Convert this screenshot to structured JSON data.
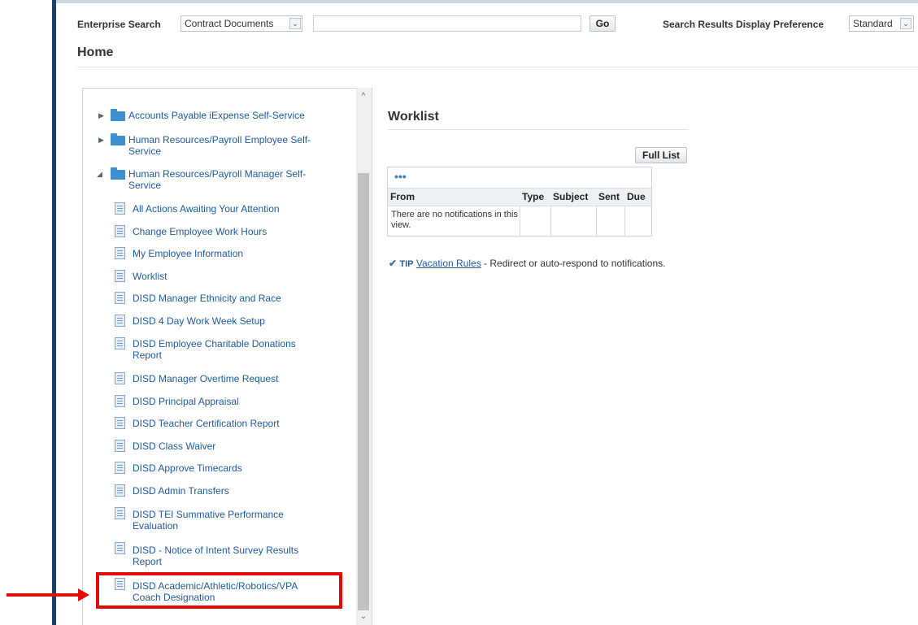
{
  "header": {
    "search_label": "Enterprise Search",
    "search_category": "Contract Documents",
    "search_value": "",
    "go_label": "Go",
    "preference_label": "Search Results Display Preference",
    "preference_value": "Standard"
  },
  "page_title": "Home",
  "navigator": {
    "folders": [
      {
        "label": "Accounts Payable iExpense Self-Service",
        "expanded": false
      },
      {
        "label": "Human Resources/Payroll Employee Self-Service",
        "expanded": false
      },
      {
        "label": "Human Resources/Payroll Manager Self-Service",
        "expanded": true
      }
    ],
    "items": [
      "All Actions Awaiting Your Attention",
      "Change Employee Work Hours",
      "My Employee Information",
      "Worklist",
      "DISD Manager Ethnicity and Race",
      "DISD 4 Day Work Week Setup",
      "DISD Employee Charitable Donations Report",
      "DISD Manager Overtime Request",
      "DISD Principal Appraisal",
      "DISD Teacher Certification Report",
      "DISD Class Waiver",
      "DISD Approve Timecards",
      "DISD Admin Transfers",
      "DISD TEI Summative Performance Evaluation",
      "DISD - Notice of Intent Survey Results Report",
      "DISD Academic/Athletic/Robotics/VPA Coach Designation"
    ]
  },
  "worklist": {
    "title": "Worklist",
    "full_list_label": "Full List",
    "more_label": "•••",
    "columns": [
      "From",
      "Type",
      "Subject",
      "Sent",
      "Due"
    ],
    "empty_message": "There are no notifications in this view."
  },
  "tip": {
    "icon": "check-circle-icon",
    "label": "TIP",
    "link_text": "Vacation Rules",
    "text": " - Redirect or auto-respond to notifications."
  },
  "colors": {
    "link": "#1f5a96",
    "highlight": "#e30b0b",
    "frame": "#1f3f64"
  }
}
